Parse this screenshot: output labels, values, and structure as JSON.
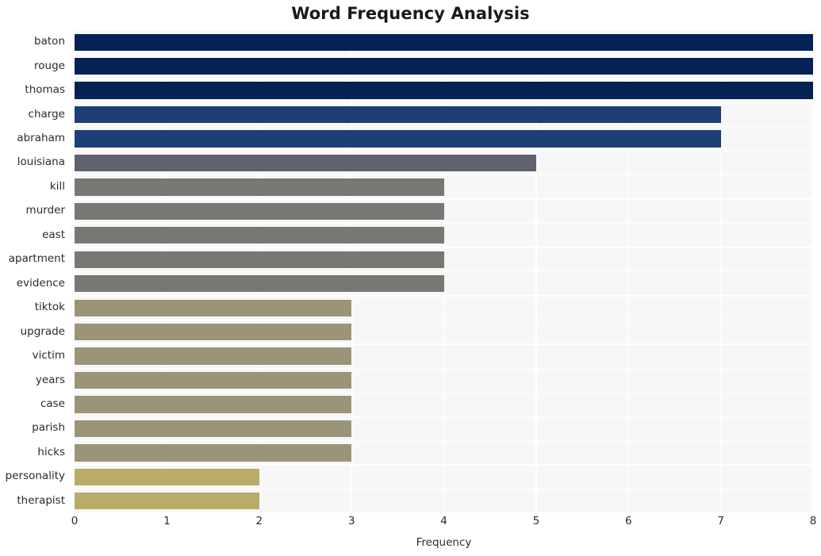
{
  "chart_data": {
    "type": "bar",
    "orientation": "horizontal",
    "title": "Word Frequency Analysis",
    "xlabel": "Frequency",
    "ylabel": "",
    "categories": [
      "baton",
      "rouge",
      "thomas",
      "charge",
      "abraham",
      "louisiana",
      "kill",
      "murder",
      "east",
      "apartment",
      "evidence",
      "tiktok",
      "upgrade",
      "victim",
      "years",
      "case",
      "parish",
      "hicks",
      "personality",
      "therapist"
    ],
    "values": [
      8,
      8,
      8,
      7,
      7,
      5,
      4,
      4,
      4,
      4,
      4,
      3,
      3,
      3,
      3,
      3,
      3,
      3,
      2,
      2
    ],
    "bar_colors": [
      "#042253",
      "#042253",
      "#042253",
      "#1e3f75",
      "#1e3f75",
      "#5f6271",
      "#787774",
      "#787774",
      "#787774",
      "#787774",
      "#787774",
      "#9a9478",
      "#9a9478",
      "#9a9478",
      "#9a9478",
      "#9a9478",
      "#9a9478",
      "#9a9478",
      "#b9ab68",
      "#b9ab68"
    ],
    "xlim": [
      0,
      8
    ],
    "xticks": [
      0,
      1,
      2,
      3,
      4,
      5,
      6,
      7,
      8
    ],
    "xtick_labels": [
      "0",
      "1",
      "2",
      "3",
      "4",
      "5",
      "6",
      "7",
      "8"
    ],
    "grid": true,
    "grid_color": "#ffffff",
    "plot_background": "#f7f7f7",
    "figure_background": "#ffffff",
    "legend": null
  }
}
